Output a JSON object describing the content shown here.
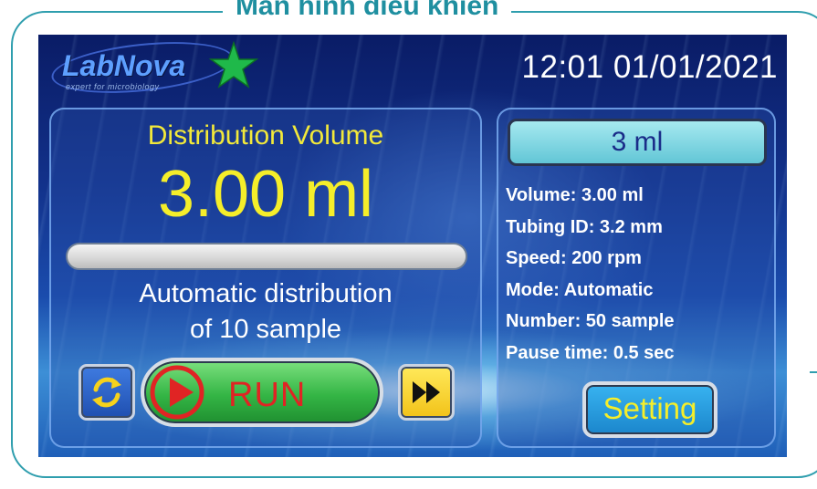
{
  "frame": {
    "title": "Màn hình điều khiển"
  },
  "logo": {
    "name": "LabNova",
    "tagline": "expert for microbiology",
    "star_icon": "star-icon",
    "accent": "#1fb94a"
  },
  "header": {
    "datetime": "12:01 01/01/2021"
  },
  "left_panel": {
    "title": "Distribution Volume",
    "value": "3.00 ml",
    "progress": 0,
    "line1": "Automatic distribution",
    "line2": "of 10 sample",
    "refresh_icon": "refresh-icon",
    "run_icon": "play-icon",
    "run_label": "RUN",
    "skip_icon": "fast-forward-icon"
  },
  "right_panel": {
    "volume_box": "3 ml",
    "info": [
      "Volume: 3.00 ml",
      "Tubing ID: 3.2 mm",
      "Speed: 200 rpm",
      "Mode: Automatic",
      "Number: 50 sample",
      "Pause time: 0.5 sec"
    ],
    "setting_label": "Setting"
  },
  "colors": {
    "value_yellow": "#f5ee2a",
    "run_red": "#e02424",
    "frame_teal": "#2f9eae"
  }
}
